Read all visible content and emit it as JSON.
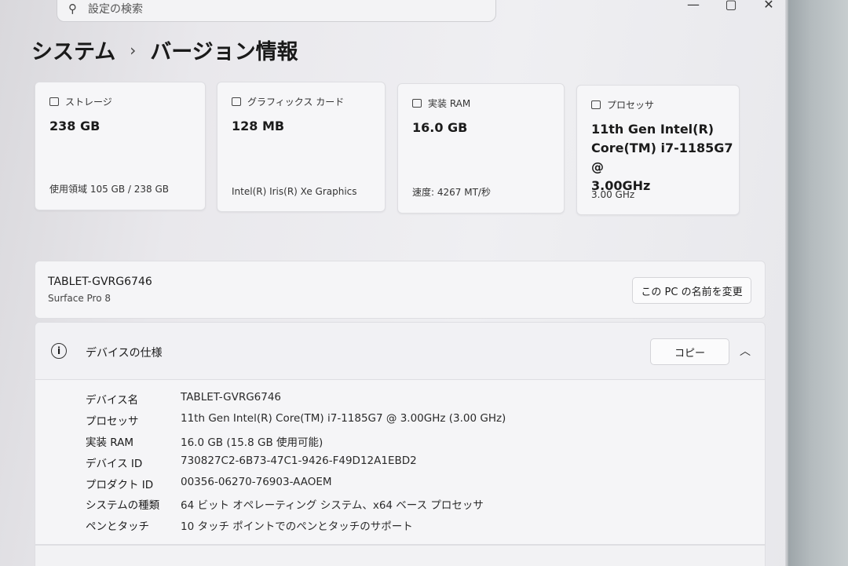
{
  "search": {
    "placeholder": "設定の検索"
  },
  "window_controls": [
    "—",
    "▢",
    "✕"
  ],
  "breadcrumb": {
    "parent": "システム",
    "separator": "›",
    "current": "バージョン情報"
  },
  "cards": [
    {
      "label": "ストレージ",
      "value": "238 GB",
      "sub": "使用領域 105 GB / 238 GB",
      "icon": "storage-icon"
    },
    {
      "label": "グラフィックス カード",
      "value": "128 MB",
      "sub": "Intel(R) Iris(R) Xe Graphics",
      "icon": "graphics-card-icon"
    },
    {
      "label": "実装 RAM",
      "value": "16.0 GB",
      "sub": "速度: 4267 MT/秒",
      "icon": "ram-icon"
    },
    {
      "label": "プロセッサ",
      "value_lines": [
        "11th Gen Intel(R)",
        "Core(TM) i7-1185G7 @",
        "3.00GHz"
      ],
      "sub": "3.00 GHz",
      "icon": "processor-icon"
    }
  ],
  "pc": {
    "name": "TABLET-GVRG6746",
    "model": "Surface Pro 8",
    "rename_label": "この PC の名前を変更"
  },
  "specs": {
    "title": "デバイスの仕様",
    "copy_label": "コピー",
    "rows": [
      {
        "k": "デバイス名",
        "v": "TABLET-GVRG6746"
      },
      {
        "k": "プロセッサ",
        "v": "11th Gen Intel(R) Core(TM) i7-1185G7 @ 3.00GHz (3.00 GHz)"
      },
      {
        "k": "実装 RAM",
        "v": "16.0 GB (15.8 GB 使用可能)"
      },
      {
        "k": "デバイス ID",
        "v": "730827C2-6B73-47C1-9426-F49D12A1EBD2"
      },
      {
        "k": "プロダクト ID",
        "v": "00356-06270-76903-AAOEM"
      },
      {
        "k": "システムの種類",
        "v": "64 ビット オペレーティング システム、x64 ベース プロセッサ"
      },
      {
        "k": "ペンとタッチ",
        "v": "10 タッチ ポイントでのペンとタッチのサポート"
      }
    ]
  }
}
